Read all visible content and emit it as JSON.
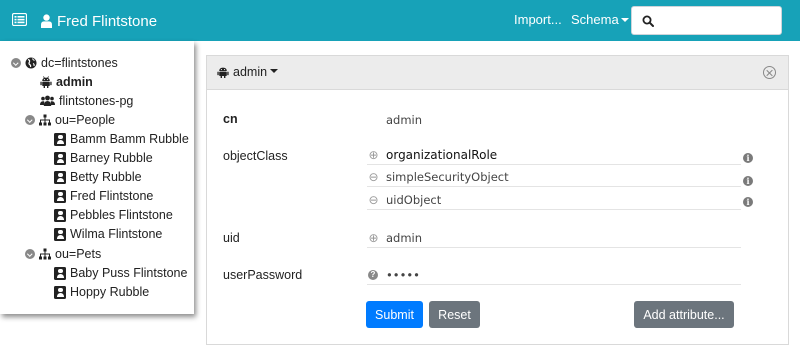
{
  "navbar": {
    "menu_icon": "list-icon",
    "title": "Fred Flintstone",
    "user_icon": "user-icon",
    "import_label": "Import...",
    "schema_label": "Schema",
    "search_icon": "search-icon",
    "search_value": "",
    "color": "#17a2b8"
  },
  "tree": {
    "items": [
      {
        "label": "dc=flintstones",
        "icon": "globe-icon",
        "expanded": true
      },
      {
        "label": "admin",
        "icon": "android-icon",
        "selected": true
      },
      {
        "label": "flintstones-pg",
        "icon": "users-icon"
      },
      {
        "label": "ou=People",
        "icon": "sitemap-icon",
        "expanded": true
      },
      {
        "label": "Bamm Bamm Rubble",
        "icon": "address-book-icon"
      },
      {
        "label": "Barney Rubble",
        "icon": "address-book-icon"
      },
      {
        "label": "Betty Rubble",
        "icon": "address-book-icon"
      },
      {
        "label": "Fred Flintstone",
        "icon": "address-book-icon"
      },
      {
        "label": "Pebbles Flintstone",
        "icon": "address-book-icon"
      },
      {
        "label": "Wilma Flintstone",
        "icon": "address-book-icon"
      },
      {
        "label": "ou=Pets",
        "icon": "sitemap-icon",
        "expanded": true
      },
      {
        "label": "Baby Puss Flintstone",
        "icon": "address-book-icon"
      },
      {
        "label": "Hoppy Rubble",
        "icon": "address-book-icon"
      }
    ]
  },
  "editor": {
    "entry_label": "admin",
    "entry_icon": "android-icon",
    "close_icon": "close-circle-icon",
    "attributes": {
      "cn": {
        "name": "cn",
        "value": "admin"
      },
      "objectClass": {
        "name": "objectClass",
        "values": [
          "organizationalRole",
          "simpleSecurityObject",
          "uidObject"
        ],
        "value_icons": [
          "add-icon",
          "remove-icon",
          "remove-icon"
        ],
        "info_icon": "info-icon"
      },
      "uid": {
        "name": "uid",
        "value": "admin",
        "icon": "add-icon"
      },
      "userPassword": {
        "name": "userPassword",
        "value": "•••••",
        "icon": "question-icon"
      }
    },
    "buttons": {
      "submit": "Submit",
      "reset": "Reset",
      "add_attribute": "Add attribute..."
    },
    "colors": {
      "primary": "#007bff",
      "secondary": "#6c757d"
    }
  }
}
